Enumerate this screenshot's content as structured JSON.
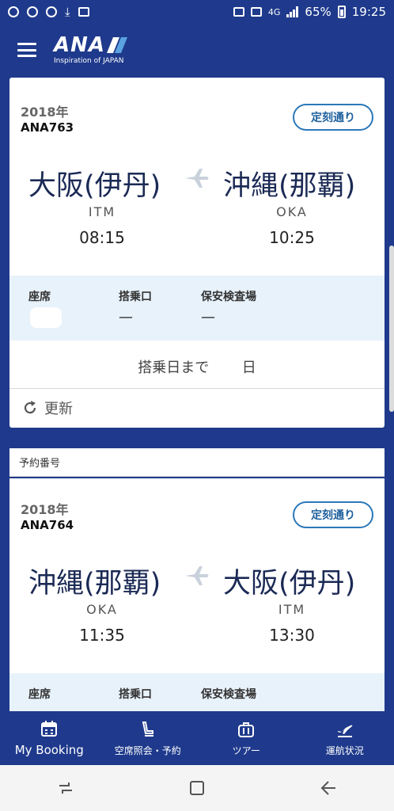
{
  "status_bar": {
    "battery": "65%",
    "time": "19:25",
    "network": "4G"
  },
  "header": {
    "logo": "ANA",
    "tagline": "Inspiration of JAPAN"
  },
  "colors": {
    "brand": "#1f3a8c",
    "pill_border": "#2b78b8",
    "band": "#e8f2fb"
  },
  "cards": [
    {
      "year": "2018年",
      "flight_no": "ANA763",
      "status": "定刻通り",
      "from_city": "大阪(伊丹)",
      "to_city": "沖縄(那覇)",
      "from_code": "ITM",
      "to_code": "OKA",
      "dep_time": "08:15",
      "arr_time": "10:25",
      "seat_label": "座席",
      "gate_label": "搭乗口",
      "gate_value": "—",
      "security_label": "保安検査場",
      "security_value": "—",
      "countdown_text": "搭乗日まで",
      "countdown_unit": "日",
      "refresh_label": "更新"
    },
    {
      "reservation_label": "予約番号",
      "year": "2018年",
      "flight_no": "ANA764",
      "status": "定刻通り",
      "from_city": "沖縄(那覇)",
      "to_city": "大阪(伊丹)",
      "from_code": "OKA",
      "to_code": "ITM",
      "dep_time": "11:35",
      "arr_time": "13:30",
      "seat_label": "座席",
      "gate_label": "搭乗口",
      "security_label": "保安検査場"
    }
  ],
  "bottom_nav": [
    {
      "label": "My Booking",
      "icon": "calendar-icon",
      "active": true
    },
    {
      "label": "空席照会・予約",
      "icon": "seat-icon",
      "active": false
    },
    {
      "label": "ツアー",
      "icon": "suitcase-icon",
      "active": false
    },
    {
      "label": "運航状況",
      "icon": "plane-departure-icon",
      "active": false
    }
  ]
}
